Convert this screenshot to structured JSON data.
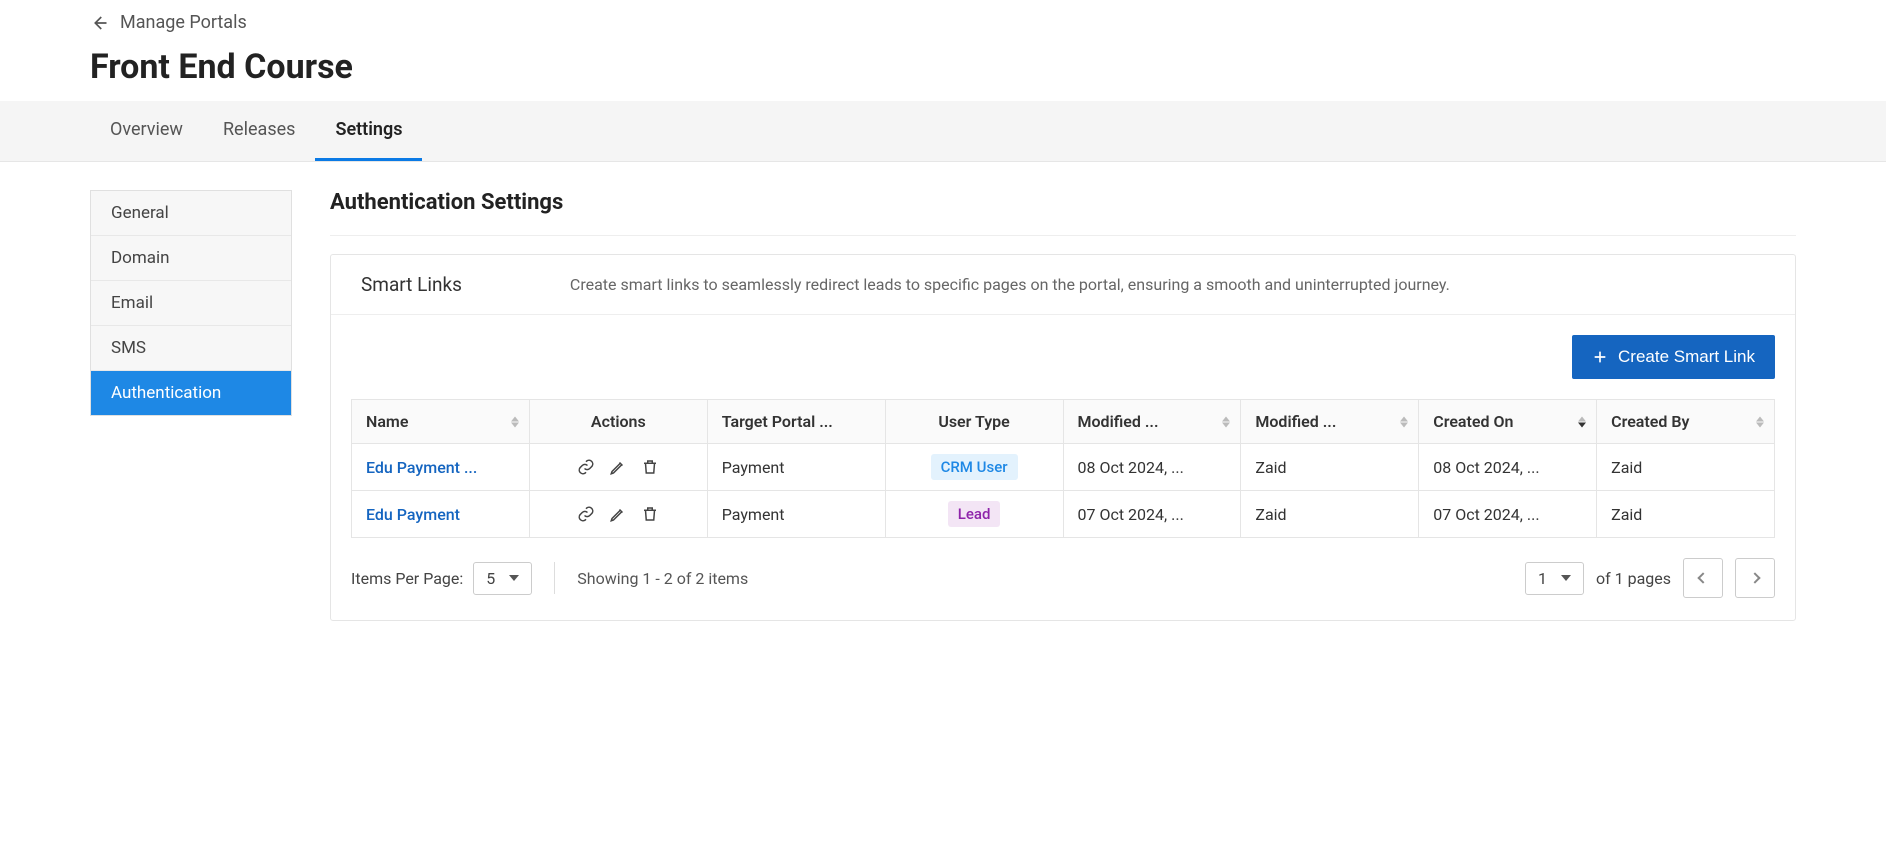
{
  "breadcrumb": {
    "label": "Manage Portals"
  },
  "page": {
    "title": "Front End Course"
  },
  "tabs": [
    {
      "label": "Overview",
      "active": false
    },
    {
      "label": "Releases",
      "active": false
    },
    {
      "label": "Settings",
      "active": true
    }
  ],
  "sidebar": {
    "items": [
      {
        "label": "General"
      },
      {
        "label": "Domain"
      },
      {
        "label": "Email"
      },
      {
        "label": "SMS"
      },
      {
        "label": "Authentication"
      }
    ],
    "activeIndex": 4
  },
  "section": {
    "title": "Authentication Settings",
    "panel_title": "Smart Links",
    "panel_desc": "Create smart links to seamlessly redirect leads to specific pages on the portal, ensuring a smooth and uninterrupted journey.",
    "create_button": "Create Smart Link"
  },
  "table": {
    "columns": {
      "name": "Name",
      "actions": "Actions",
      "target": "Target Portal ...",
      "user_type": "User Type",
      "modified_on": "Modified ...",
      "modified_by": "Modified ...",
      "created_on": "Created On",
      "created_by": "Created By"
    },
    "rows": [
      {
        "name": "Edu Payment ...",
        "target": "Payment",
        "user_type": "CRM User",
        "user_type_class": "crm",
        "modified_on": "08 Oct 2024, ...",
        "modified_by": "Zaid",
        "created_on": "08 Oct 2024, ...",
        "created_by": "Zaid"
      },
      {
        "name": "Edu Payment",
        "target": "Payment",
        "user_type": "Lead",
        "user_type_class": "lead",
        "modified_on": "07 Oct 2024, ...",
        "modified_by": "Zaid",
        "created_on": "07 Oct 2024, ...",
        "created_by": "Zaid"
      }
    ]
  },
  "pagination": {
    "items_per_label": "Items Per Page:",
    "items_per_value": "5",
    "showing": "Showing 1 - 2 of 2 items",
    "page_value": "1",
    "of_pages": "of 1 pages"
  }
}
